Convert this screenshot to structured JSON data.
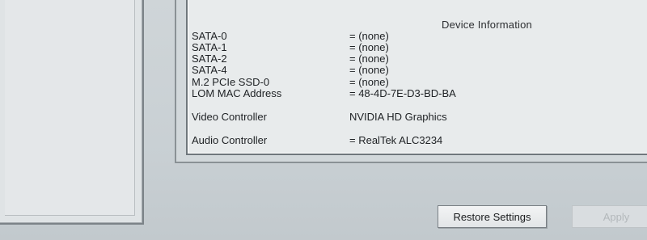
{
  "device_info": {
    "title": "Device Information",
    "rows": [
      {
        "label": "SATA-0",
        "value": "= (none)"
      },
      {
        "label": "SATA-1",
        "value": "= (none)"
      },
      {
        "label": "SATA-2",
        "value": "= (none)"
      },
      {
        "label": "SATA-4",
        "value": "= (none)"
      },
      {
        "label": "M.2 PCIe SSD-0",
        "value": "= (none)"
      },
      {
        "label": "LOM MAC Address",
        "value": "= 48-4D-7E-D3-BD-BA"
      },
      {
        "label": "Video Controller",
        "value": "NVIDIA HD Graphics"
      },
      {
        "label": "Audio Controller",
        "value": "= RealTek ALC3234"
      }
    ]
  },
  "buttons": {
    "restore_label": "Restore Settings",
    "apply_label": "Apply"
  }
}
